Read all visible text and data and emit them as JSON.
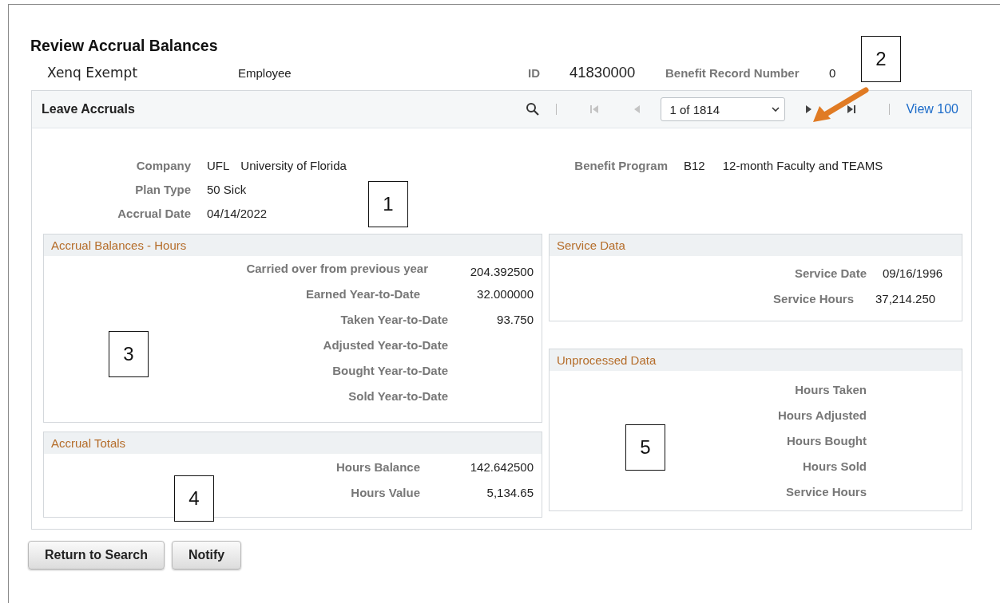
{
  "page_title": "Review Accrual Balances",
  "header": {
    "name": "Xenq Exempt",
    "role": "Employee",
    "id_label": "ID",
    "id": "41830000",
    "benefit_record_label": "Benefit Record Number",
    "benefit_record": "0"
  },
  "panel": {
    "title": "Leave Accruals",
    "pager": "1 of 1814",
    "view_all": "View 100",
    "pager_buttons": [
      {
        "kind": "first",
        "disabled": true
      },
      {
        "kind": "prev",
        "disabled": true
      },
      {
        "kind": "next",
        "disabled": false
      },
      {
        "kind": "last",
        "disabled": false
      }
    ]
  },
  "fields": [
    {
      "label": "Company",
      "values": [
        "UFL",
        "University of Florida"
      ]
    },
    {
      "label": "Plan Type",
      "values": [
        "50 Sick"
      ]
    },
    {
      "label": "Accrual Date",
      "values": [
        "04/14/2022"
      ]
    }
  ],
  "benefit_program": {
    "label": "Benefit Program",
    "values": [
      "B12",
      "12-month Faculty and TEAMS"
    ]
  },
  "accrual_balances": {
    "title": "Accrual Balances - Hours",
    "rows": [
      {
        "label": "Carried over from previous year",
        "value": "204.392500"
      },
      {
        "label": "Earned Year-to-Date",
        "value": "32.000000"
      },
      {
        "label": "Taken Year-to-Date",
        "value": "93.750"
      },
      {
        "label": "Adjusted Year-to-Date"
      },
      {
        "label": "Bought Year-to-Date"
      },
      {
        "label": "Sold Year-to-Date"
      }
    ]
  },
  "accrual_totals": {
    "title": "Accrual Totals",
    "rows": [
      {
        "label": "Hours Balance",
        "value": "142.642500"
      },
      {
        "label": "Hours Value",
        "value": "5,134.65"
      }
    ]
  },
  "service_data": {
    "title": "Service Data",
    "rows": [
      {
        "label": "Service Date",
        "value": "09/16/1996"
      },
      {
        "label": "Service Hours",
        "value": "37,214.250"
      }
    ]
  },
  "unprocessed_data": {
    "title": "Unprocessed Data",
    "rows": [
      {
        "label": "Hours Taken"
      },
      {
        "label": "Hours Adjusted"
      },
      {
        "label": "Hours Bought"
      },
      {
        "label": "Hours Sold"
      },
      {
        "label": "Service Hours"
      }
    ]
  },
  "buttons": [
    "Return to Search",
    "Notify"
  ],
  "callouts": [
    {
      "label": "1"
    },
    {
      "label": "2"
    },
    {
      "label": "3"
    },
    {
      "label": "4"
    },
    {
      "label": "5"
    }
  ]
}
